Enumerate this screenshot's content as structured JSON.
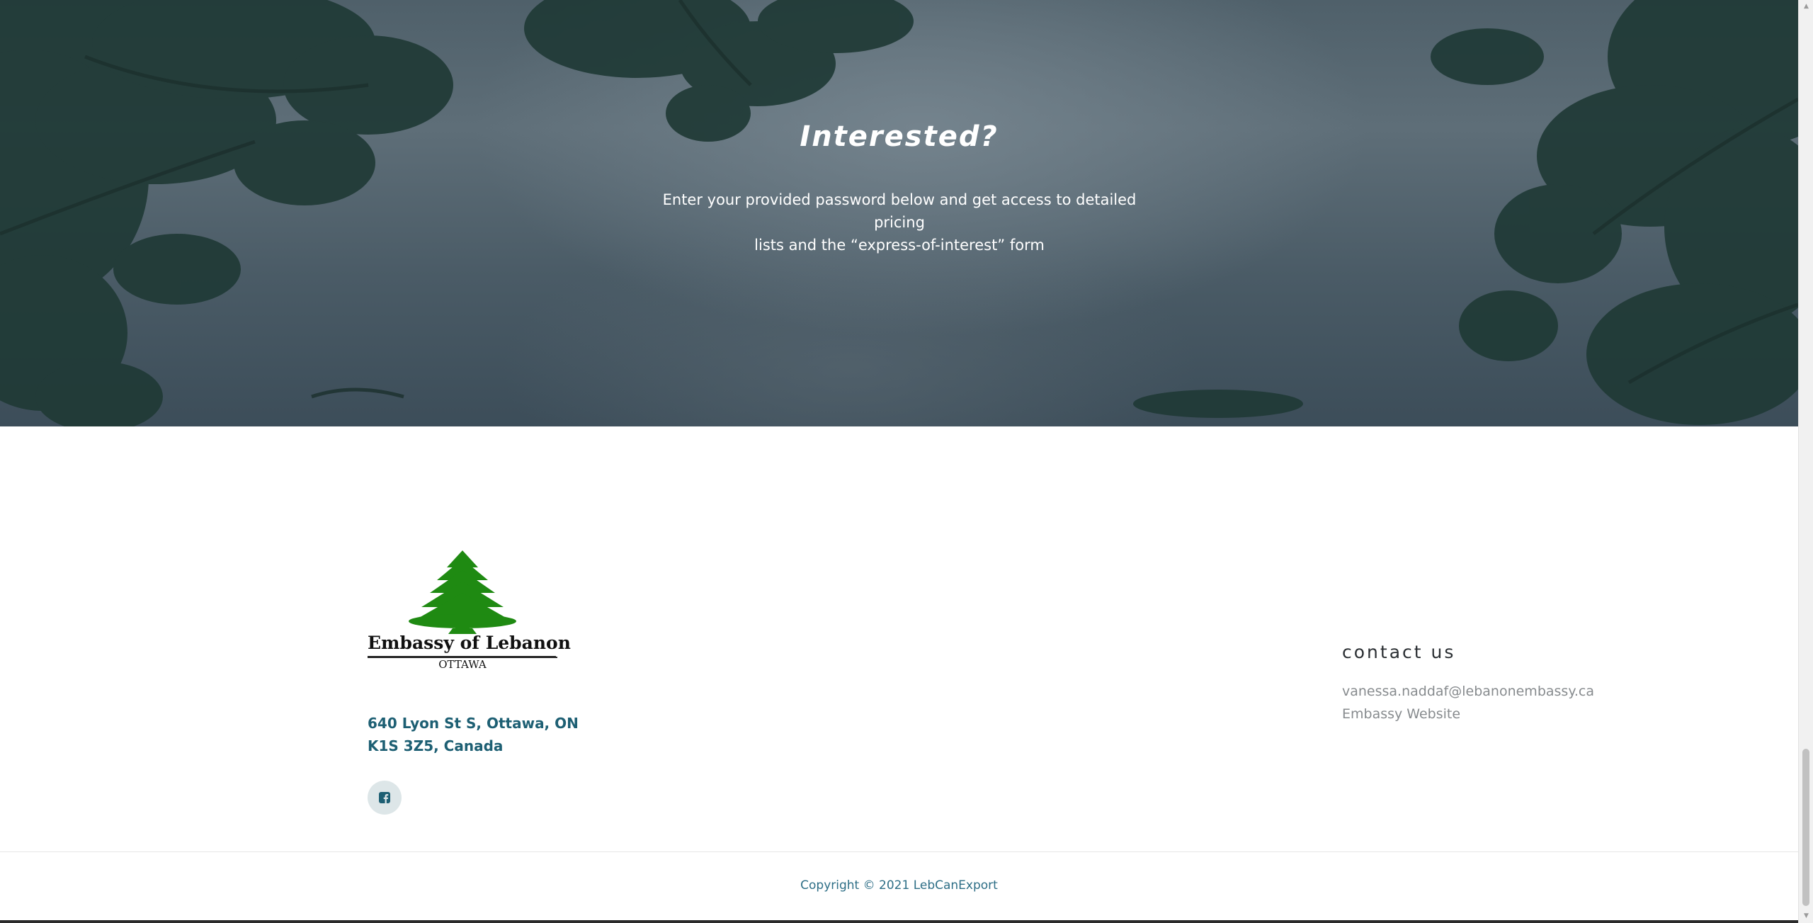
{
  "hero": {
    "title": "Interested?",
    "description_line1": "Enter your provided password below and get access to detailed pricing",
    "description_line2": "lists and the “express-of-interest” form"
  },
  "footer": {
    "logo": {
      "title": "Embassy of Lebanon",
      "subtitle": "OTTAWA",
      "icon": "cedar-tree-icon",
      "color": "#1f8a12"
    },
    "address_line1": "640 Lyon St S, Ottawa, ON",
    "address_line2": "K1S 3Z5, Canada",
    "social": {
      "icon": "facebook-icon"
    },
    "contact": {
      "title": "contact us",
      "email": "vanessa.naddaf@lebanonembassy.ca",
      "website_label": "Embassy Website"
    },
    "copyright": "Copyright © 2021 LebCanExport"
  },
  "colors": {
    "accent": "#1d5f73",
    "link_gray": "#878b8e",
    "copyright_blue": "#2d6e86"
  }
}
